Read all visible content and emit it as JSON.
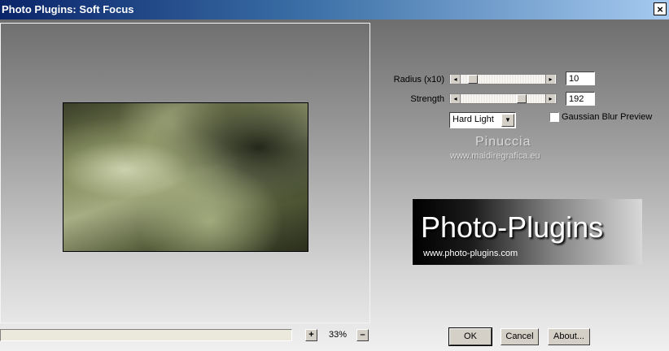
{
  "window": {
    "title": "Photo Plugins: Soft Focus",
    "close_label": "×"
  },
  "controls": {
    "radius": {
      "label": "Radius (x10)",
      "value": "10"
    },
    "strength": {
      "label": "Strength",
      "value": "192"
    },
    "blend_mode": {
      "selected": "Hard Light"
    },
    "gaussian": {
      "label": "Gaussian Blur Preview",
      "checked": false
    }
  },
  "watermark": {
    "name": "Pinuccia",
    "url": "www.maidiregrafica.eu"
  },
  "logo": {
    "title": "Photo-Plugins",
    "url": "www.photo-plugins.com"
  },
  "zoom": {
    "plus_label": "+",
    "minus_label": "–",
    "level": "33%"
  },
  "buttons": {
    "ok": "OK",
    "cancel": "Cancel",
    "about": "About..."
  }
}
